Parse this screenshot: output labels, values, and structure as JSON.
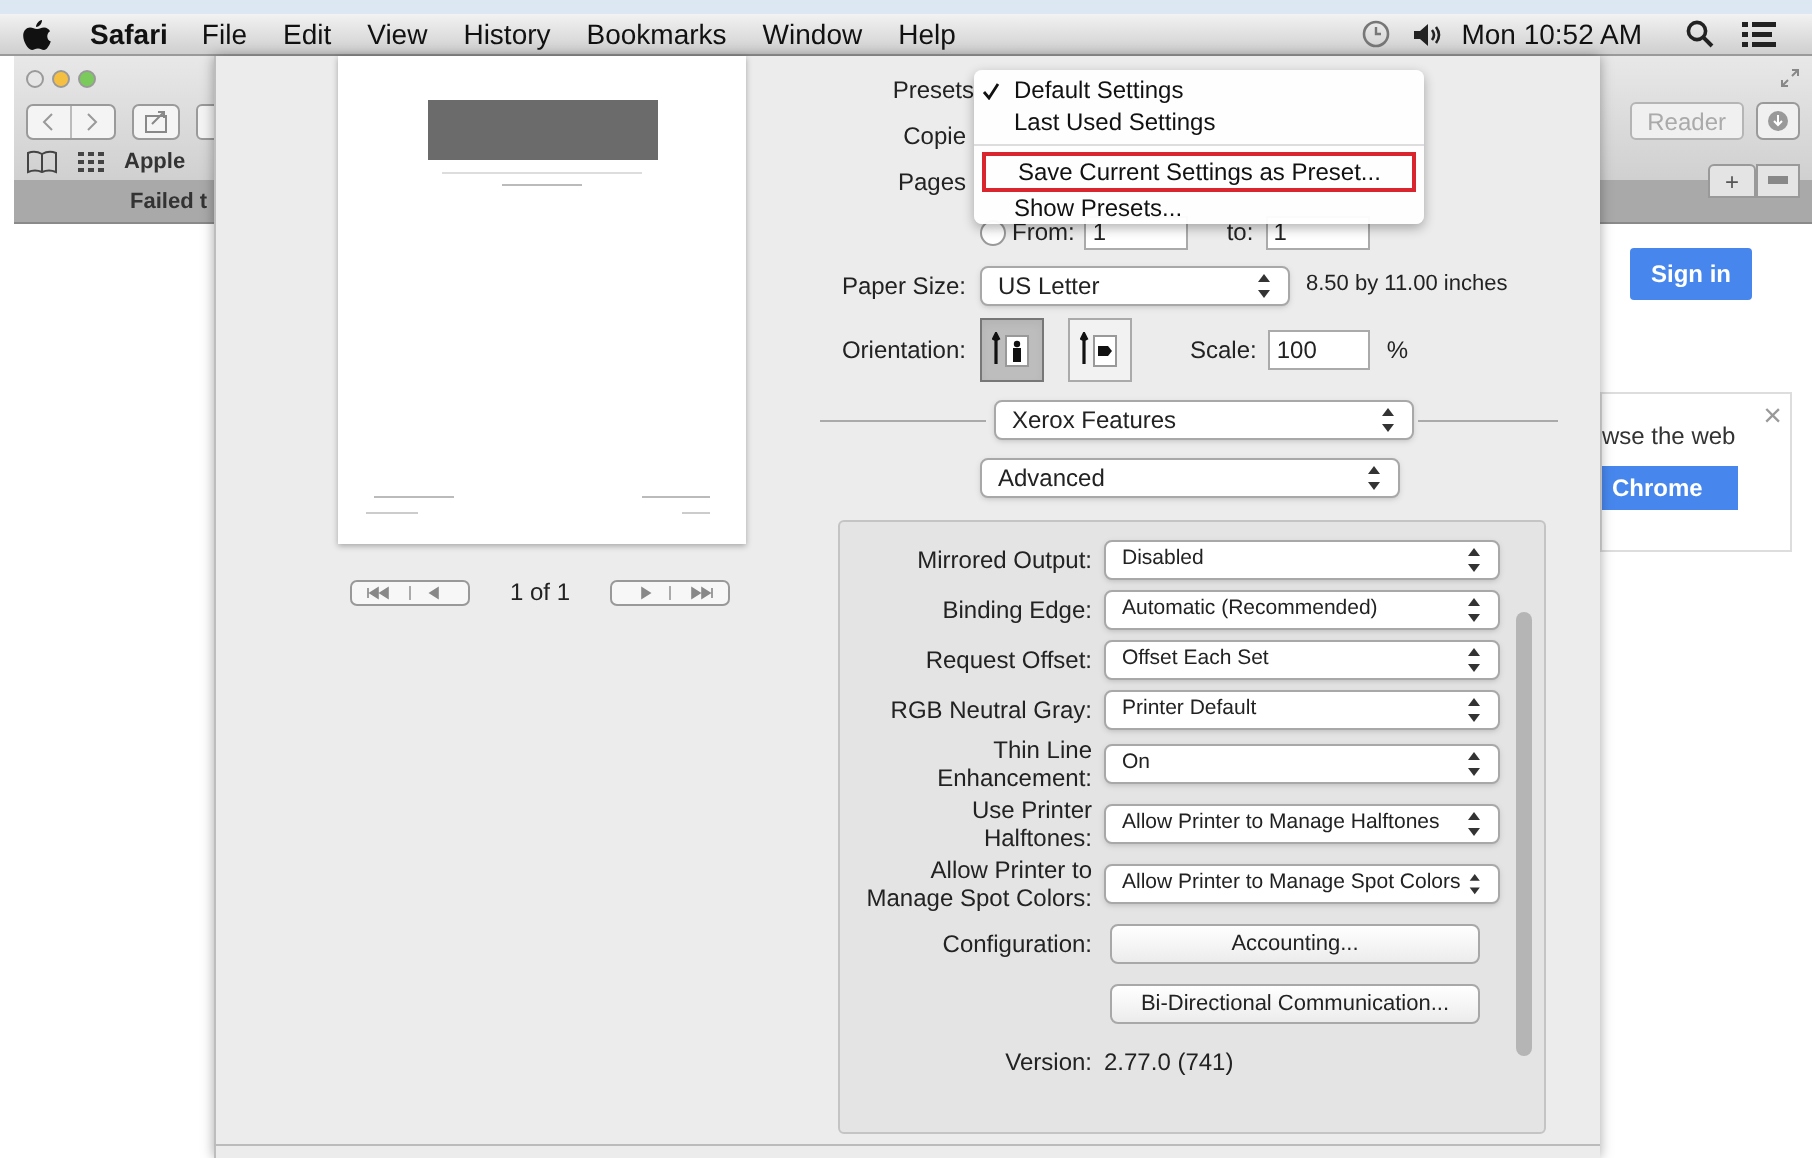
{
  "menu_bar": {
    "app": "Safari",
    "items": [
      "File",
      "Edit",
      "View",
      "History",
      "Bookmarks",
      "Window",
      "Help"
    ],
    "clock": "Mon 10:52 AM"
  },
  "browser": {
    "bookmarks": [
      "Apple"
    ],
    "tab_title": "Failed t",
    "reader_button": "Reader",
    "new_tab_button": "+",
    "sign_in_button": "Sign in",
    "promo": {
      "text": "wse the web",
      "button": "Chrome",
      "close": "×"
    }
  },
  "print_dialog": {
    "presets_label": "Presets",
    "copies_label": "Copie",
    "pages_label": "Pages",
    "range": {
      "selected": false,
      "from_label": "From:",
      "from_value": "1",
      "to_label": "to:",
      "to_value": "1"
    },
    "paper_size": {
      "label": "Paper Size:",
      "value": "US Letter",
      "note": "8.50 by 11.00 inches"
    },
    "orientation": {
      "label": "Orientation:",
      "options": [
        {
          "selected": true
        },
        {
          "selected": false
        }
      ]
    },
    "scale": {
      "label": "Scale:",
      "value": "100",
      "unit": "%"
    },
    "feature_menu": "Xerox Features",
    "panel_menu": "Advanced",
    "settings": [
      {
        "kind": "select",
        "label": "Mirrored Output:",
        "value": "Disabled"
      },
      {
        "kind": "select",
        "label": "Binding Edge:",
        "value": "Automatic (Recommended)"
      },
      {
        "kind": "select",
        "label": "Request Offset:",
        "value": "Offset Each Set"
      },
      {
        "kind": "select",
        "label": "RGB Neutral Gray:",
        "value": "Printer Default"
      },
      {
        "kind": "select",
        "label": "Thin Line Enhancement:",
        "value": "On"
      },
      {
        "kind": "select",
        "label": "Use Printer Halftones:",
        "value": "Allow Printer to Manage Halftones"
      },
      {
        "kind": "select",
        "label": "Allow Printer to Manage Spot Colors:",
        "value": "Allow Printer to Manage Spot Colors"
      },
      {
        "kind": "button",
        "label": "Configuration:",
        "value": "Accounting..."
      },
      {
        "kind": "button",
        "value": "Bi-Directional Communication..."
      },
      {
        "kind": "text",
        "label": "Version:",
        "value": "2.77.0 (741)"
      }
    ],
    "page_counter": "1 of 1",
    "presets_menu": [
      {
        "kind": "option",
        "label": "Default Settings",
        "checked": true,
        "highlighted": false
      },
      {
        "kind": "option",
        "label": "Last Used Settings",
        "checked": false,
        "highlighted": false
      },
      {
        "kind": "separator"
      },
      {
        "kind": "option",
        "label": "Save Current Settings as Preset...",
        "checked": false,
        "highlighted": true
      },
      {
        "kind": "option",
        "label": "Show Presets...",
        "checked": false,
        "highlighted": false
      }
    ]
  }
}
